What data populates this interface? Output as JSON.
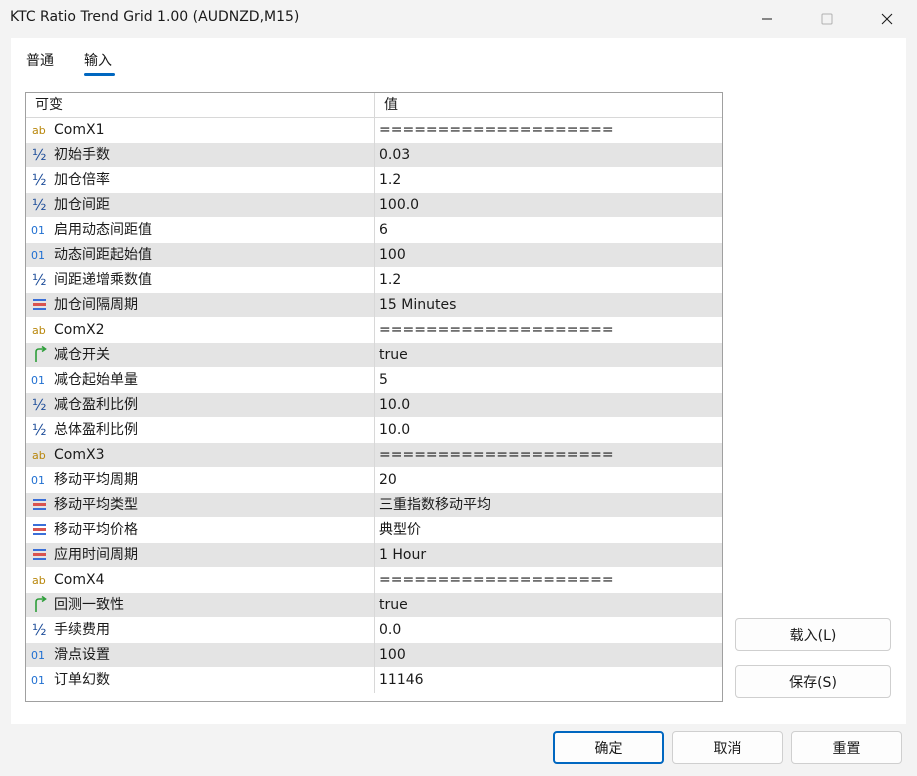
{
  "window": {
    "title": "KTC Ratio Trend Grid 1.00 (AUDNZD,M15)"
  },
  "tabs": [
    {
      "label": "普通",
      "active": false
    },
    {
      "label": "输入",
      "active": true
    }
  ],
  "grid": {
    "header": {
      "name": "可变",
      "value": "值"
    },
    "rows": [
      {
        "icon": "text-icon",
        "name": "ComX1",
        "value": "===================="
      },
      {
        "icon": "fraction-icon",
        "name": "初始手数",
        "value": "0.03"
      },
      {
        "icon": "fraction-icon",
        "name": "加仓倍率",
        "value": "1.2"
      },
      {
        "icon": "fraction-icon",
        "name": "加仓间距",
        "value": "100.0"
      },
      {
        "icon": "integer-icon",
        "name": "启用动态间距值",
        "value": "6"
      },
      {
        "icon": "integer-icon",
        "name": "动态间距起始值",
        "value": "100"
      },
      {
        "icon": "fraction-icon",
        "name": "间距递增乘数值",
        "value": "1.2"
      },
      {
        "icon": "enum-icon",
        "name": "加仓间隔周期",
        "value": "15 Minutes"
      },
      {
        "icon": "text-icon",
        "name": "ComX2",
        "value": "===================="
      },
      {
        "icon": "bool-icon",
        "name": "减仓开关",
        "value": "true"
      },
      {
        "icon": "integer-icon",
        "name": "减仓起始单量",
        "value": "5"
      },
      {
        "icon": "fraction-icon",
        "name": "减仓盈利比例",
        "value": "10.0"
      },
      {
        "icon": "fraction-icon",
        "name": "总体盈利比例",
        "value": "10.0"
      },
      {
        "icon": "text-icon",
        "name": "ComX3",
        "value": "===================="
      },
      {
        "icon": "integer-icon",
        "name": "移动平均周期",
        "value": "20"
      },
      {
        "icon": "enum-icon",
        "name": "移动平均类型",
        "value": "三重指数移动平均"
      },
      {
        "icon": "enum-icon",
        "name": "移动平均价格",
        "value": "典型价"
      },
      {
        "icon": "enum-icon",
        "name": "应用时间周期",
        "value": "1 Hour"
      },
      {
        "icon": "text-icon",
        "name": "ComX4",
        "value": "===================="
      },
      {
        "icon": "bool-icon",
        "name": "回测一致性",
        "value": "true"
      },
      {
        "icon": "fraction-icon",
        "name": "手续费用",
        "value": "0.0"
      },
      {
        "icon": "integer-icon",
        "name": "滑点设置",
        "value": "100"
      },
      {
        "icon": "integer-icon",
        "name": "订单幻数",
        "value": "11146"
      }
    ]
  },
  "side_buttons": {
    "load": "载入(L)",
    "save": "保存(S)"
  },
  "bottom_buttons": {
    "ok": "确定",
    "cancel": "取消",
    "reset": "重置"
  },
  "icon_labels": {
    "text": "ab",
    "fraction": "½",
    "integer": "01"
  },
  "colors": {
    "accent": "#0067c0",
    "text_icon": "#b8860b",
    "fraction_icon": "#1f4e9a",
    "integer_icon": "#1f6fd1",
    "enum_icon_blue": "#3a6fd8",
    "enum_icon_red": "#d9534f",
    "bool_icon": "#2e9e3a",
    "row_alt": "#e4e4e4"
  }
}
